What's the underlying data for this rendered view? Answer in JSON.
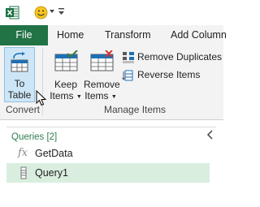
{
  "titlebar": {
    "app_icon": "excel-icon",
    "qat_icon": "smiley-icon",
    "customize_icon": "customize-qat-icon"
  },
  "tabs": [
    {
      "label": "File",
      "active": true
    },
    {
      "label": "Home"
    },
    {
      "label": "Transform"
    },
    {
      "label": "Add Column"
    }
  ],
  "ribbon": {
    "to_table": {
      "line1": "To",
      "line2": "Table",
      "icon": "to-table-icon"
    },
    "keep_items": {
      "line1": "Keep",
      "line2": "Items",
      "icon": "keep-items-icon"
    },
    "remove_items": {
      "line1": "Remove",
      "line2": "Items",
      "icon": "remove-items-icon"
    },
    "remove_duplicates": {
      "label": "Remove Duplicates",
      "icon": "remove-duplicates-icon"
    },
    "reverse_items": {
      "label": "Reverse Items",
      "icon": "reverse-items-icon"
    },
    "groups": {
      "convert": "Convert",
      "manage_items": "Manage Items"
    }
  },
  "queries": {
    "header": "Queries [2]",
    "items": [
      {
        "label": "GetData",
        "icon": "fx-icon"
      },
      {
        "label": "Query1",
        "icon": "list-icon",
        "selected": true
      }
    ]
  },
  "colors": {
    "file_tab": "#217346",
    "selected_query": "#d9eedf",
    "hover_button": "#cde6f7",
    "queries_header": "#2e7d4f"
  }
}
